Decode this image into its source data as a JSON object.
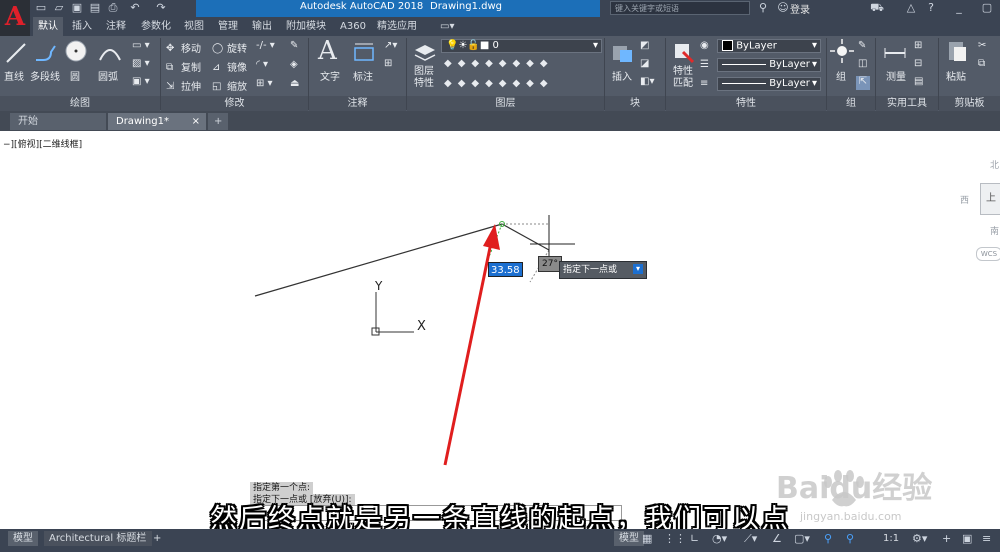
{
  "app": {
    "logo": "A",
    "title_app": "Autodesk AutoCAD 2018",
    "title_file": "Drawing1.dwg",
    "search_placeholder": "键入关键字或短语",
    "login": "登录"
  },
  "ribbon_tabs": [
    "默认",
    "插入",
    "注释",
    "参数化",
    "视图",
    "管理",
    "输出",
    "附加模块",
    "A360",
    "精选应用"
  ],
  "panels": {
    "draw": {
      "title": "绘图",
      "line": "直线",
      "polyline": "多段线",
      "circle": "圆",
      "arc": "圆弧"
    },
    "modify": {
      "title": "修改",
      "move": "移动",
      "rotate": "旋转",
      "copy": "复制",
      "mirror": "镜像",
      "stretch": "拉伸",
      "scale": "缩放"
    },
    "annotation": {
      "title": "注释",
      "text": "文字",
      "dimension": "标注"
    },
    "layers": {
      "title": "图层",
      "layer_props": "图层特性",
      "current_layer": "0"
    },
    "block": {
      "title": "块",
      "insert": "插入"
    },
    "properties": {
      "title": "特性",
      "match": "特性匹配",
      "color": "ByLayer",
      "linetype": "ByLayer",
      "lineweight": "ByLayer"
    },
    "groups": {
      "title": "组",
      "group": "组"
    },
    "utilities": {
      "title": "实用工具",
      "measure": "测量"
    },
    "clipboard": {
      "title": "剪贴板",
      "paste": "粘贴"
    }
  },
  "file_tabs": {
    "start": "开始",
    "drawing": "Drawing1*",
    "new": "+"
  },
  "viewport": {
    "label": "−][俯视][二维线框]",
    "viewcube_north": "北",
    "viewcube_west": "西",
    "viewcube_top": "上",
    "viewcube_south": "南",
    "wcs": "WCS",
    "axis_y": "Y",
    "axis_x": "X"
  },
  "dynamic_input": {
    "length": "33.58",
    "angle": "27°",
    "prompt": "指定下一点或"
  },
  "command": {
    "line1": "指定第一个点:",
    "line2": "指定下一点或 [放弃(U)]:"
  },
  "layout_tabs": [
    "模型",
    "Architectural 标题栏",
    "+"
  ],
  "status": {
    "model": "模型",
    "scale": "1:1"
  },
  "subtitle": "然后终点就是另一条直线的起点，我们可以点",
  "watermark": {
    "brand": "Baidu经验",
    "url": "jingyan.baidu.com"
  }
}
